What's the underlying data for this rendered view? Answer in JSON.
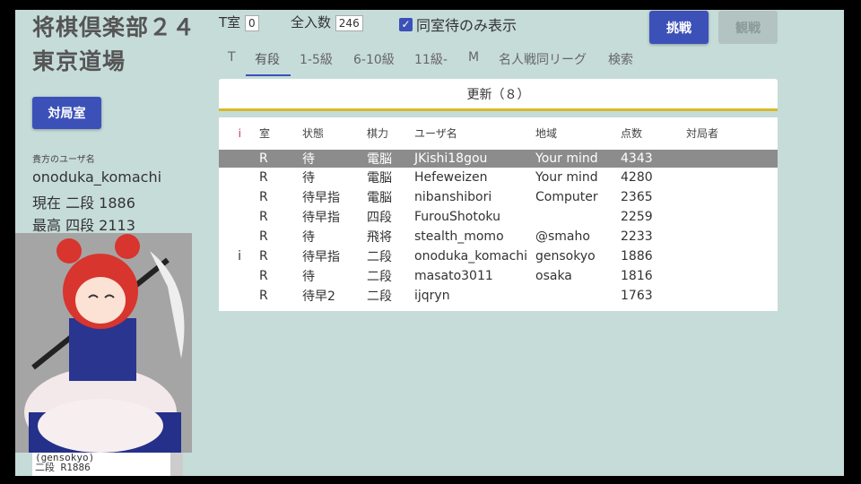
{
  "title_line1": "将棋倶楽部２４",
  "title_line2": "東京道場",
  "room_button": "対局室",
  "user_label": "貴方のユーザ名",
  "username": "onoduka_komachi",
  "current": "現在 二段 1886",
  "best": "最高 四段 2113",
  "caption_lines": [
    "(gensokyo)",
    "二段 R1886"
  ],
  "t_room_label": "T室",
  "t_room_value": "0",
  "total_label": "全入数",
  "total_value": "246",
  "checkbox_label": "同室待のみ表示",
  "challenge_button": "挑戦",
  "watch_button": "観戦",
  "tabs": [
    "T",
    "有段",
    "1-5級",
    "6-10級",
    "11級-",
    "M",
    "名人戦同リーグ",
    "検索"
  ],
  "active_tab": 1,
  "refresh_button": "更新（８）",
  "accent": "#3c51b8",
  "columns": [
    "i",
    "室",
    "状態",
    "棋力",
    "ユーザ名",
    "地域",
    "点数",
    "対局者"
  ],
  "rows": [
    [
      "",
      "R",
      "待",
      "電脳",
      "JKishi18gou",
      "Your mind",
      "4343",
      ""
    ],
    [
      "",
      "R",
      "待",
      "電脳",
      "Hefeweizen",
      "Your mind",
      "4280",
      ""
    ],
    [
      "",
      "R",
      "待早指",
      "電脳",
      "nibanshibori",
      "Computer",
      "2365",
      ""
    ],
    [
      "",
      "R",
      "待早指",
      "四段",
      "FurouShotoku",
      "",
      "2259",
      ""
    ],
    [
      "",
      "R",
      "待",
      "飛将",
      "stealth_momo",
      "@smaho",
      "2233",
      ""
    ],
    [
      "i",
      "R",
      "待早指",
      "二段",
      "onoduka_komachi",
      "gensokyo",
      "1886",
      ""
    ],
    [
      "",
      "R",
      "待",
      "二段",
      "masato3011",
      "osaka",
      "1816",
      ""
    ],
    [
      "",
      "R",
      "待早2",
      "二段",
      "ijqryn",
      "",
      "1763",
      ""
    ]
  ]
}
